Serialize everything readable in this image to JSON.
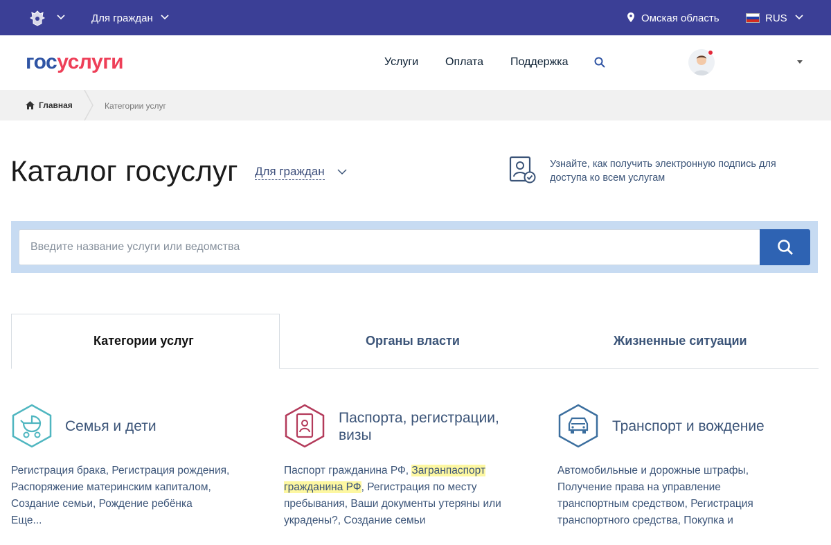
{
  "topbar": {
    "audience": "Для граждан",
    "region": "Омская область",
    "language": "RUS"
  },
  "header": {
    "logo_part1": "гос",
    "logo_part2": "услуги",
    "nav": [
      "Услуги",
      "Оплата",
      "Поддержка"
    ]
  },
  "breadcrumb": {
    "home": "Главная",
    "current": "Категории услуг"
  },
  "catalog": {
    "title": "Каталог госуслуг",
    "audience": "Для граждан",
    "signature_info": "Узнайте, как получить электронную подпись для доступа ко всем услугам"
  },
  "search": {
    "placeholder": "Введите название услуги или ведомства"
  },
  "tabs": [
    "Категории услуг",
    "Органы власти",
    "Жизненные ситуации"
  ],
  "categories": [
    {
      "title": "Семья и дети",
      "links": "Регистрация брака, Регистрация рождения, Распоряжение материнским капиталом, Создание семьи, Рождение ребёнка",
      "more": "Еще..."
    },
    {
      "title": "Паспорта, регистрации, визы",
      "links_before": "Паспорт гражданина РФ, ",
      "links_highlight": "Загранпаспорт гражданина РФ",
      "links_after": ", Регистрация по месту пребывания, Ваши документы утеряны или украдены?, Создание семьи"
    },
    {
      "title": "Транспорт и вождение",
      "links": "Автомобильные и дорожные штрафы, Получение права на управление транспортным средством, Регистрация транспортного средства, Покупка и"
    }
  ],
  "colors": {
    "topbar": "#3b3f96",
    "logo_blue": "#2f54a4",
    "logo_red": "#ee3f58",
    "search_button": "#2e63b3",
    "family_icon": "#4fb6c0",
    "passport_icon": "#b33a5a",
    "transport_icon": "#3b6e9e"
  }
}
